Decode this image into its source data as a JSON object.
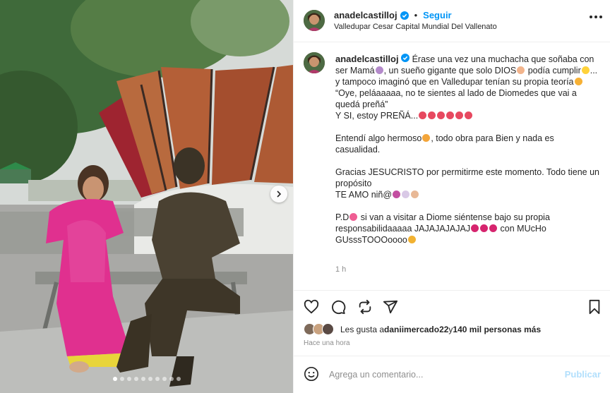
{
  "header": {
    "username": "anadelcastilloj",
    "separator": "•",
    "follow_label": "Seguir",
    "location": "Valledupar Cesar Capital Mundial Del Vallenato"
  },
  "caption": {
    "username": "anadelcastilloj",
    "line1": "Érase una vez una muchacha que soñaba con ser Mamá",
    "line1b": ", un sueño gigante que solo DIOS",
    "line1c": " podía cumplir",
    "line1d": "... y tampoco imaginó que en Valledupar tenían su propia teoría",
    "line2": "“Oye, peláaaaaa, no te sientes al lado de Diomedes que vai a quedá preñá”",
    "line3": "Y SI, estoy PREÑÁ...",
    "line4a": "Entendí algo hermoso",
    "line4b": ", todo obra para Bien y nada es casualidad.",
    "line5": "Gracias JESUCRISTO por permitirme este momento. Todo tiene un propósito",
    "line6": "TE AMO niñ@",
    "line7a": "P.D",
    "line7b": " si van a visitar a Diome siéntense bajo su propia responsabilidaaaaa JAJAJAJAJAJ",
    "line7c": " con MUcHo GUsssTOOOoooo",
    "timestamp": "1 h"
  },
  "likes": {
    "prefix": "Les gusta a ",
    "user": "daniimercado22",
    "middle": " y ",
    "count": "140 mil personas más"
  },
  "posted_ago": "Hace una hora",
  "composer": {
    "placeholder": "Agrega un comentario...",
    "publish_label": "Publicar"
  },
  "icons": {
    "like": "heart-icon",
    "comment": "comment-icon",
    "share": "share-icon",
    "send": "send-icon",
    "save": "bookmark-icon",
    "more": "more-icon",
    "emoji": "emoji-icon",
    "verified": "verified-icon",
    "carousel_next": "chevron-right-icon"
  },
  "carousel": {
    "count": 10,
    "active_index": 0
  },
  "colors": {
    "accent": "#0095f6",
    "publish_disabled": "#b2dffc",
    "muted_text": "#8e8e8e",
    "border": "#efefef"
  }
}
